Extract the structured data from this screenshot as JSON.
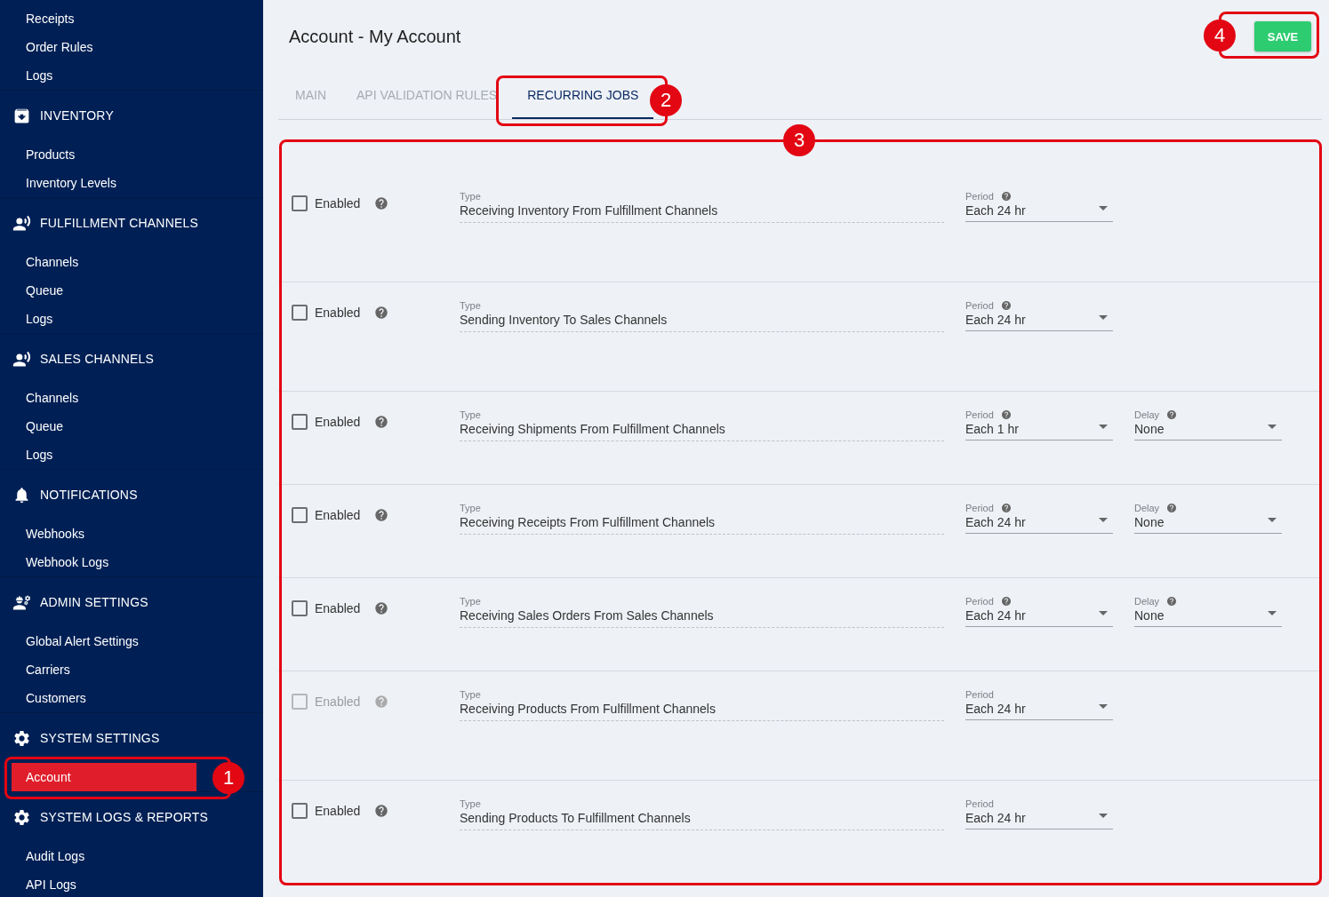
{
  "sidebar": {
    "groups": [
      {
        "items": [
          {
            "label": "Receipts",
            "selected": false
          },
          {
            "label": "Order Rules",
            "selected": false
          },
          {
            "label": "Logs",
            "selected": false
          }
        ]
      },
      {
        "title": "INVENTORY",
        "items": [
          {
            "label": "Products",
            "selected": false
          },
          {
            "label": "Inventory Levels",
            "selected": false
          }
        ]
      },
      {
        "title": "FULFILLMENT CHANNELS",
        "items": [
          {
            "label": "Channels",
            "selected": false
          },
          {
            "label": "Queue",
            "selected": false
          },
          {
            "label": "Logs",
            "selected": false
          }
        ]
      },
      {
        "title": "SALES CHANNELS",
        "items": [
          {
            "label": "Channels",
            "selected": false
          },
          {
            "label": "Queue",
            "selected": false
          },
          {
            "label": "Logs",
            "selected": false
          }
        ]
      },
      {
        "title": "NOTIFICATIONS",
        "items": [
          {
            "label": "Webhooks",
            "selected": false
          },
          {
            "label": "Webhook Logs",
            "selected": false
          }
        ]
      },
      {
        "title": "ADMIN SETTINGS",
        "items": [
          {
            "label": "Global Alert Settings",
            "selected": false
          },
          {
            "label": "Carriers",
            "selected": false
          },
          {
            "label": "Customers",
            "selected": false
          }
        ]
      },
      {
        "title": "SYSTEM SETTINGS",
        "items": [
          {
            "label": "Account",
            "selected": true
          }
        ]
      },
      {
        "title": "SYSTEM LOGS & REPORTS",
        "items": [
          {
            "label": "Audit Logs",
            "selected": false
          },
          {
            "label": "API Logs",
            "selected": false
          }
        ]
      }
    ]
  },
  "page": {
    "title": "Account - My Account",
    "save_button": "SAVE"
  },
  "tabs": [
    {
      "label": "MAIN",
      "selected": false
    },
    {
      "label": "API VALIDATION RULES",
      "selected": false
    },
    {
      "label": "RECURRING JOBS",
      "selected": true
    }
  ],
  "jobs": [
    {
      "enabled_label": "Enabled",
      "checked": false,
      "disabled": false,
      "type_label": "Type",
      "type": "Receiving Inventory From Fulfillment Channels",
      "selects": [
        {
          "kind": "help",
          "label": "Period",
          "value": "Each 24 hr"
        }
      ]
    },
    {
      "enabled_label": "Enabled",
      "checked": false,
      "disabled": false,
      "type_label": "Type",
      "type": "Sending Inventory To Sales Channels",
      "selects": [
        {
          "kind": "help",
          "label": "Period",
          "value": "Each 24 hr"
        }
      ]
    },
    {
      "enabled_label": "Enabled",
      "checked": false,
      "disabled": false,
      "type_label": "Type",
      "type": "Receiving Shipments From Fulfillment Channels",
      "selects": [
        {
          "kind": "help",
          "label": "Period",
          "value": "Each 1 hr"
        },
        {
          "kind": "help",
          "label": "Delay",
          "value": "None"
        }
      ]
    },
    {
      "enabled_label": "Enabled",
      "checked": false,
      "disabled": false,
      "type_label": "Type",
      "type": "Receiving Receipts From Fulfillment Channels",
      "selects": [
        {
          "kind": "help",
          "label": "Period",
          "value": "Each 24 hr"
        },
        {
          "kind": "help",
          "label": "Delay",
          "value": "None"
        }
      ]
    },
    {
      "enabled_label": "Enabled",
      "checked": false,
      "disabled": false,
      "type_label": "Type",
      "type": "Receiving Sales Orders From Sales Channels",
      "selects": [
        {
          "kind": "help",
          "label": "Period",
          "value": "Each 24 hr"
        },
        {
          "kind": "help",
          "label": "Delay",
          "value": "None"
        }
      ]
    },
    {
      "enabled_label": "Enabled",
      "checked": false,
      "disabled": true,
      "type_label": "Type",
      "type": "Receiving Products From Fulfillment Channels",
      "selects": [
        {
          "kind": "plain",
          "label": "Period",
          "value": "Each 24 hr"
        }
      ]
    },
    {
      "enabled_label": "Enabled",
      "checked": false,
      "disabled": false,
      "type_label": "Type",
      "type": "Sending Products To Fulfillment Channels",
      "selects": [
        {
          "kind": "plain",
          "label": "Period",
          "value": "Each 24 hr"
        }
      ]
    }
  ],
  "annotations": [
    {
      "label": "1"
    },
    {
      "label": "2"
    },
    {
      "label": "3"
    },
    {
      "label": "4"
    }
  ]
}
